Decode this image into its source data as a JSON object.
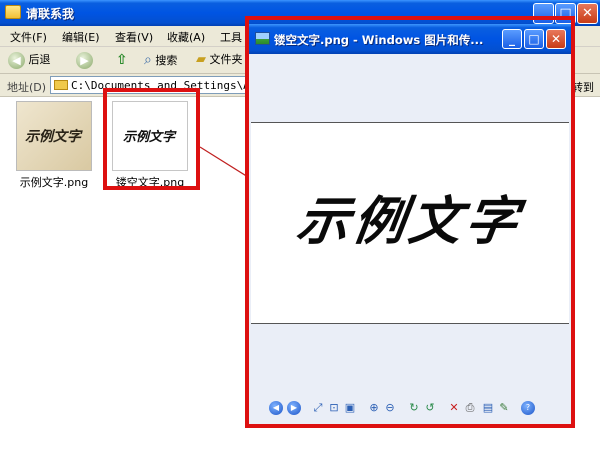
{
  "explorer": {
    "title": "请联系我",
    "menus": [
      "文件(F)",
      "编辑(E)",
      "查看(V)",
      "收藏(A)",
      "工具"
    ],
    "toolbar": {
      "back": "后退",
      "search": "搜索",
      "folders": "文件夹"
    },
    "address_label": "地址(D)",
    "address": "C:\\Documents and Settings\\Admi",
    "goto": "转到",
    "files": [
      {
        "name": "示例文字.png",
        "thumb_text": "示例文字"
      },
      {
        "name": "镂空文字.png",
        "thumb_text": "示例文字"
      }
    ]
  },
  "viewer": {
    "title": "镂空文字.png - Windows 图片和传...",
    "image_text": "示例文字"
  },
  "accent": {
    "highlight": "#dd1010",
    "xp_blue": "#0054e3",
    "arrow": "#c02020"
  },
  "icons": [
    "folder-icon",
    "back-icon",
    "forward-icon",
    "up-folder-icon",
    "search-icon",
    "folders-icon",
    "minimize-icon",
    "maximize-icon",
    "close-icon",
    "image-app-icon",
    "prev-image-icon",
    "next-image-icon",
    "best-fit-icon",
    "actual-size-icon",
    "slideshow-icon",
    "zoom-in-icon",
    "zoom-out-icon",
    "rotate-cw-icon",
    "rotate-ccw-icon",
    "delete-icon",
    "print-icon",
    "copy-to-icon",
    "edit-icon",
    "help-icon"
  ]
}
